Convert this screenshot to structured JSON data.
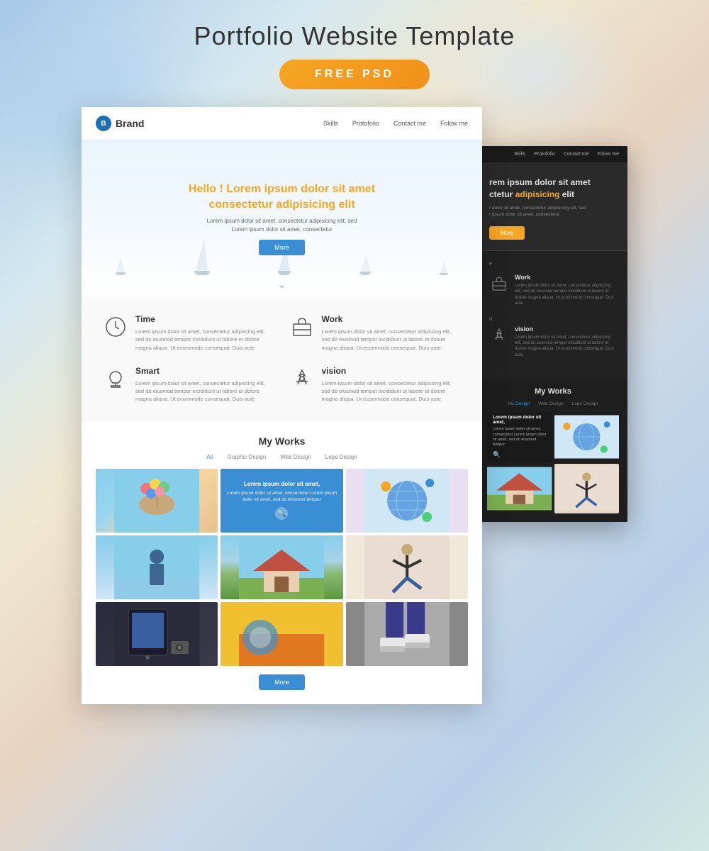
{
  "page": {
    "title": "Portfolio Website Template",
    "badge": "FREE PSD"
  },
  "light_template": {
    "nav": {
      "brand": "Brand",
      "links": [
        "Skills",
        "Protofolio",
        "Contact me",
        "Folow me"
      ]
    },
    "hero": {
      "title_line1": "Hello ! Lorem ipsum dolor sit amet",
      "title_line2": "consectetur ",
      "title_highlight": "adipisicing",
      "title_line3": " elit",
      "subtitle": "Lorem ipsum dolor sit amet, consectetur adipisicing elit, sed\nLorem ipsum dolor sit amet, consectetur",
      "button": "More"
    },
    "features": [
      {
        "icon": "⏱",
        "title": "Time",
        "text": "Lorem ipsum dolor sit amet, consectetur adipiscing elit, sed do eiusmod tempor incididunt ut labore et dolore magna aliqua. Ut ecommodo consequat. Duis aute"
      },
      {
        "icon": "💼",
        "title": "Work",
        "text": "Lorem ipsum dolor sit amet, consectetur adipiscing elit, sed do eiusmod tempor incididunt ut labore et dolore magna aliqua. Ut ecommodo consequat. Duis aute"
      },
      {
        "icon": "☕",
        "title": "Smart",
        "text": "Lorem ipsum dolor sit amet, consectetur adipiscing elit, sed do eiusmod tempor incididunt ut labore et dolore magna aliqua. Ut ecommodo consequat. Duis aute"
      },
      {
        "icon": "🌱",
        "title": "vision",
        "text": "Lorem ipsum dolor sit amet, consectetur adipiscing elit, sed do eiusmod tempor incididunt ut labore et dolore magna aliqua. Ut ecommodo consequat. Duis aute"
      }
    ],
    "portfolio": {
      "title": "My Works",
      "filters": [
        "All",
        "Graphic Design",
        "Web Design",
        "Logo Design"
      ],
      "active_filter": "All",
      "overlay_title": "Lorem ipsum dolor sit amet,",
      "overlay_text": "Lorem ipsum dolor sit amet, consectetur Lorem ipsum dolor sit amet, sed do eiusmod tempur",
      "more_button": "More"
    }
  },
  "dark_template": {
    "nav": {
      "links": [
        "Skills",
        "Protofolio",
        "Contact me",
        "Folow me"
      ]
    },
    "hero": {
      "title_line1": "rem ipsum dolor sit amet",
      "title_line2": "ctetur ",
      "title_highlight": "adipisicing",
      "title_line3": " elit",
      "subtitle": "r dolor sit amet, consectetur adipisicing elit, sed\nr ipsum dolor sit amet, consectetur",
      "button": "More"
    },
    "features": [
      {
        "icon": "💼",
        "title": "Work",
        "text": "Lorem ipsum dolor sit amet, consectetur adipiscing elit, sed do eiusmod tempor incididunt ut labore et dolore magna aliqua. Ut ecommodo consequat. Duis aute"
      },
      {
        "icon": "🌱",
        "title": "vision",
        "text": "Lorem ipsum dolor sit amet, consectetur adipiscing elit, sed do eiusmod tempor incididunt ut labore et dolore magna aliqua. Ut ecommodo consequat. Duis aute"
      }
    ],
    "portfolio": {
      "title": "My Works",
      "filters": [
        "hic Design",
        "Web Design",
        "Logo Design"
      ],
      "overlay_title": "Lorem ipsum dolor sit amet,",
      "overlay_text": "Lorem ipsum dolor sit amet, consectetur Lorem ipsum dolor sit amet, sed do eiusmod tempur"
    }
  }
}
